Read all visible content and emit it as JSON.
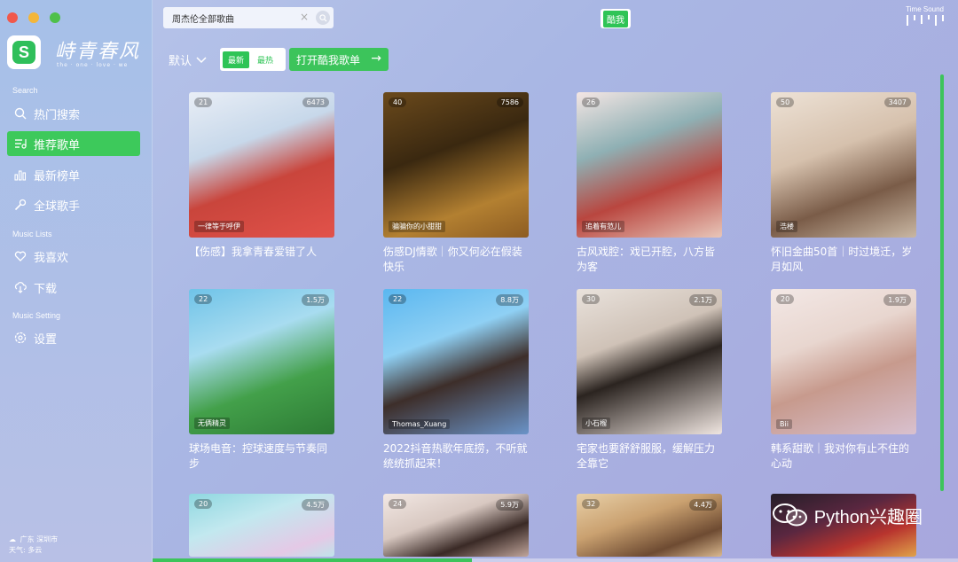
{
  "sidebar": {
    "logo_text": "峙青春风",
    "logo_sub": "the · one · love · we",
    "sections": {
      "search": "Search",
      "music_lists": "Music Lists",
      "music_setting": "Music Setting"
    },
    "items": [
      {
        "label": "热门搜索",
        "icon": "search-icon"
      },
      {
        "label": "推荐歌单",
        "icon": "playlist-icon"
      },
      {
        "label": "最新榜单",
        "icon": "chart-icon"
      },
      {
        "label": "全球歌手",
        "icon": "singer-icon"
      },
      {
        "label": "我喜欢",
        "icon": "heart-icon"
      },
      {
        "label": "下载",
        "icon": "download-icon"
      },
      {
        "label": "设置",
        "icon": "gear-icon"
      }
    ],
    "location_line1": "广东 深圳市",
    "location_line2": "天气: 多云"
  },
  "topbar": {
    "search_value": "周杰伦全部歌曲",
    "kuwo_label": "酷我",
    "brand": "Time Sound"
  },
  "filter": {
    "default_label": "默认",
    "seg_new": "最新",
    "seg_hot": "最热",
    "open_label": "打开酷我歌单"
  },
  "cards": [
    {
      "plays": "21",
      "count": "6473",
      "author": "一律等于呼伊",
      "title": "【伤感】我拿青春爱错了人"
    },
    {
      "plays": "40",
      "count": "7586",
      "author": "骗骗你的小甜甜",
      "title": "伤感DJ情歌｜你又何必在假装快乐"
    },
    {
      "plays": "26",
      "count": "",
      "author": "追着有范儿",
      "title": "古风戏腔：戏已开腔，八方皆为客"
    },
    {
      "plays": "50",
      "count": "3407",
      "author": "浩楼",
      "title": "怀旧金曲50首｜时过境迁，岁月如风"
    },
    {
      "plays": "22",
      "count": "1.5万",
      "author": "无俩精灵",
      "title": "球场电音：控球速度与节奏同步"
    },
    {
      "plays": "22",
      "count": "8.8万",
      "author": "Thomas_Xuang",
      "title": "2022抖音热歌年底捞，不听就统统抓起来！"
    },
    {
      "plays": "30",
      "count": "2.1万",
      "author": "小石榴",
      "title": "宅家也要舒舒服服，缓解压力全靠它"
    },
    {
      "plays": "20",
      "count": "1.9万",
      "author": "Bii",
      "title": "韩系甜歌｜我对你有止不住的心动"
    },
    {
      "plays": "20",
      "count": "4.5万",
      "author": "",
      "title": ""
    },
    {
      "plays": "24",
      "count": "5.9万",
      "author": "",
      "title": ""
    },
    {
      "plays": "32",
      "count": "4.4万",
      "author": "",
      "title": ""
    },
    {
      "plays": "",
      "count": "",
      "author": "",
      "title": ""
    }
  ],
  "watermark": "Python兴趣圈"
}
